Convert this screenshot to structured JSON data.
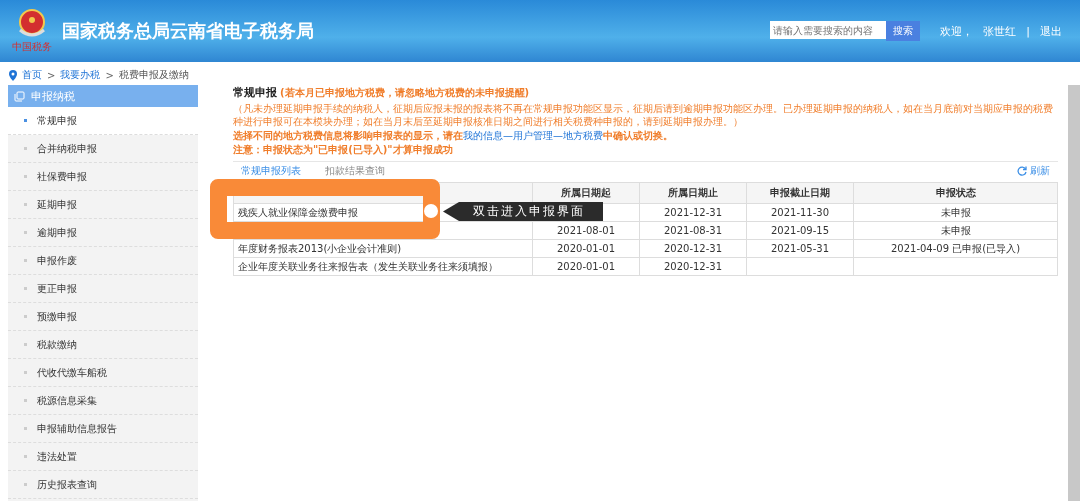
{
  "header": {
    "logo_caption": "中国税务",
    "title": "国家税务总局云南省电子税务局",
    "search": {
      "placeholder": "请输入需要搜索的内容",
      "button": "搜索"
    },
    "welcome": "欢迎，",
    "user": "张世红",
    "separator": "|",
    "logout": "退出"
  },
  "breadcrumb": {
    "items": [
      "首页",
      "我要办税",
      "税费申报及缴纳"
    ],
    "separators": [
      ">",
      ">"
    ]
  },
  "sidebar": {
    "title": "申报纳税",
    "items": [
      {
        "label": "常规申报",
        "selected": true
      },
      {
        "label": "合并纳税申报",
        "selected": false
      },
      {
        "label": "社保费申报",
        "selected": false
      },
      {
        "label": "延期申报",
        "selected": false
      },
      {
        "label": "逾期申报",
        "selected": false
      },
      {
        "label": "申报作废",
        "selected": false
      },
      {
        "label": "更正申报",
        "selected": false
      },
      {
        "label": "预缴申报",
        "selected": false
      },
      {
        "label": "税款缴纳",
        "selected": false
      },
      {
        "label": "代收代缴车船税",
        "selected": false
      },
      {
        "label": "税源信息采集",
        "selected": false
      },
      {
        "label": "申报辅助信息报告",
        "selected": false
      },
      {
        "label": "违法处置",
        "selected": false
      },
      {
        "label": "历史报表查询",
        "selected": false
      }
    ]
  },
  "main": {
    "title": "常规申报",
    "title_note": "(若本月已申报地方税费，请忽略地方税费的未申报提醒)",
    "notice": "（凡未办理延期申报手续的纳税人，征期后应报未报的报表将不再在常规申报功能区显示，征期后请到逾期申报功能区办理。已办理延期申报的纳税人，如在当月底前对当期应申报的税费种进行申报可在本模块办理；如在当月末后至延期申报核准日期之间进行相关税费种申报的，请到延期申报办理。）",
    "hint_before": "选择不同的地方税费信息将影响申报表的显示，请在",
    "hint_link": "我的信息—用户管理—地方税费",
    "hint_after": "中确认或切换。",
    "warning": "注意：申报状态为\"已申报(已导入)\"才算申报成功",
    "tabs": [
      {
        "label": "常规申报列表",
        "selected": true
      },
      {
        "label": "扣款结果查询",
        "selected": false
      }
    ],
    "refresh": "刷新",
    "table": {
      "columns": [
        null,
        "所属日期起",
        "所属日期止",
        "申报截止日期",
        "申报状态"
      ],
      "rows": [
        [
          "残疾人就业保障金缴费申报",
          null,
          "2021-12-31",
          "2021-11-30",
          "未申报"
        ],
        [
          null,
          "2021-08-01",
          "2021-08-31",
          "2021-09-15",
          "未申报"
        ],
        [
          "年度财务报表2013(小企业会计准则)",
          "2020-01-01",
          "2020-12-31",
          "2021-05-31",
          "2021-04-09 已申报(已导入)"
        ],
        [
          "企业年度关联业务往来报告表（发生关联业务往来须填报）",
          "2020-01-01",
          "2020-12-31",
          null,
          null
        ]
      ]
    }
  },
  "callout": {
    "text": "双击进入申报界面"
  }
}
